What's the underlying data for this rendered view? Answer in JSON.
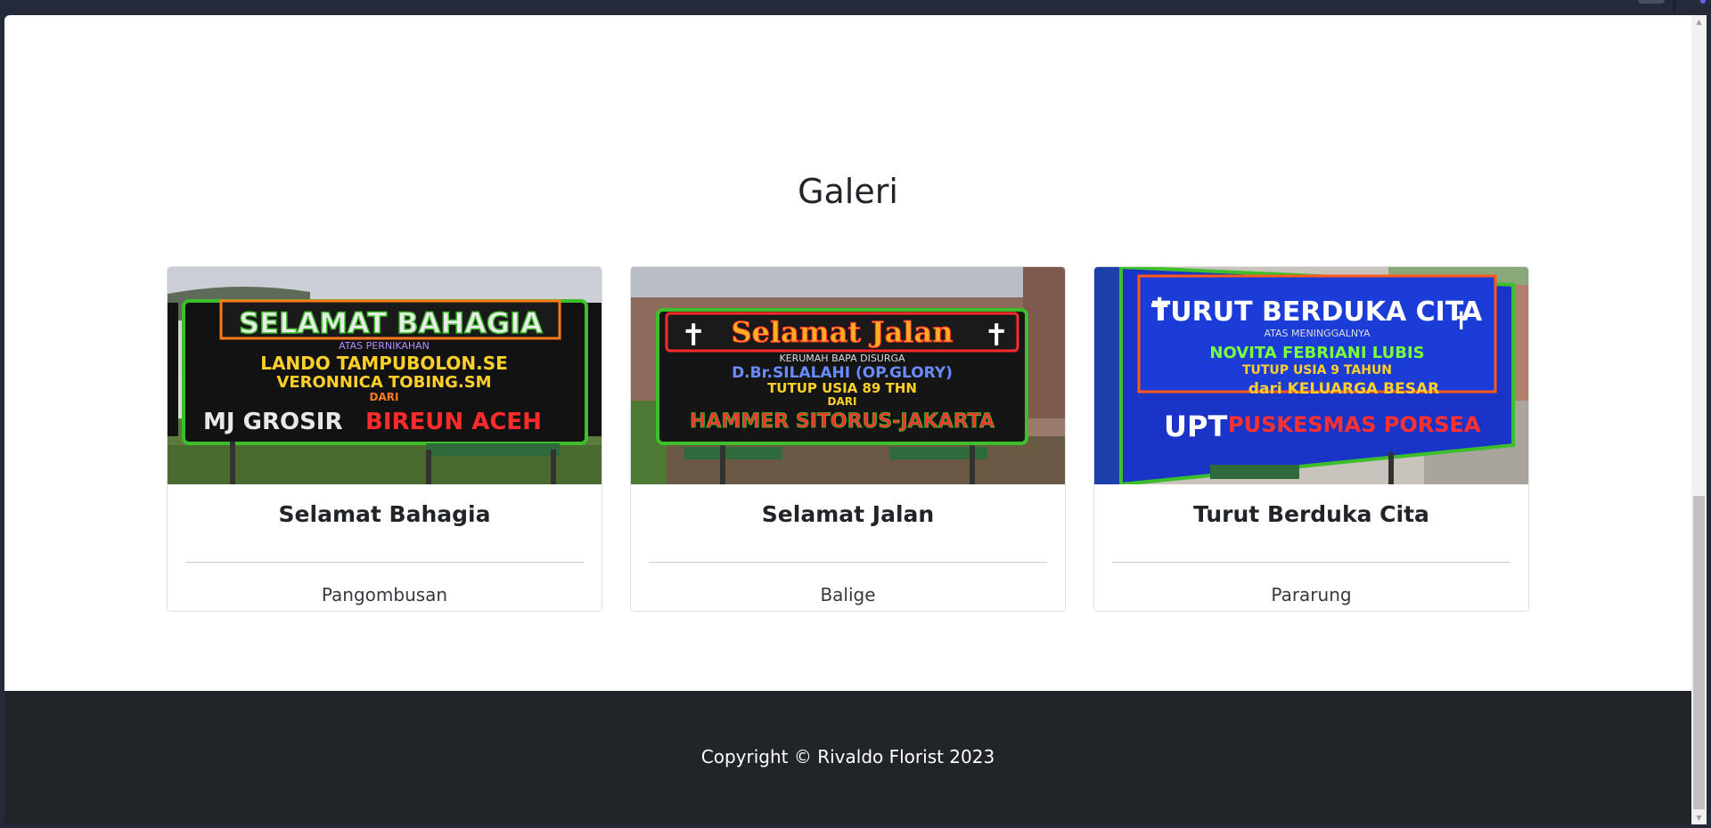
{
  "gallery": {
    "title": "Galeri",
    "items": [
      {
        "title": "Selamat Bahagia",
        "location": "Pangombusan",
        "image_text": [
          "SELAMAT BAHAGIA",
          "ATAS PERNIKAHAN",
          "LANDO TAMPUBOLON.SE",
          "VERONNICA TOBING.SM",
          "DARI",
          "MJ GROSIR",
          "BIREUN ACEH"
        ]
      },
      {
        "title": "Selamat Jalan",
        "location": "Balige",
        "image_text": [
          "Selamat Jalan",
          "KERUMAH BAPA DISURGA",
          "D.Br.SILALAHI (OP.GLORY)",
          "TUTUP USIA 89 THN",
          "DARI",
          "HAMMER SITORUS-JAKARTA"
        ]
      },
      {
        "title": "Turut Berduka Cita",
        "location": "Pararung",
        "image_text": [
          "TURUT BERDUKA CITA",
          "ATAS MENINGGALNYA",
          "NOVITA FEBRIANI LUBIS",
          "TUTUP USIA 9 TAHUN",
          "dari KELUARGA BESAR",
          "UPT",
          "PUSKESMAS PORSEA"
        ]
      }
    ]
  },
  "footer": {
    "copyright": "Copyright © Rivaldo Florist 2023"
  },
  "colors": {
    "footer_bg": "#212529",
    "text": "#212529",
    "browser_chrome": "#252a3a"
  }
}
